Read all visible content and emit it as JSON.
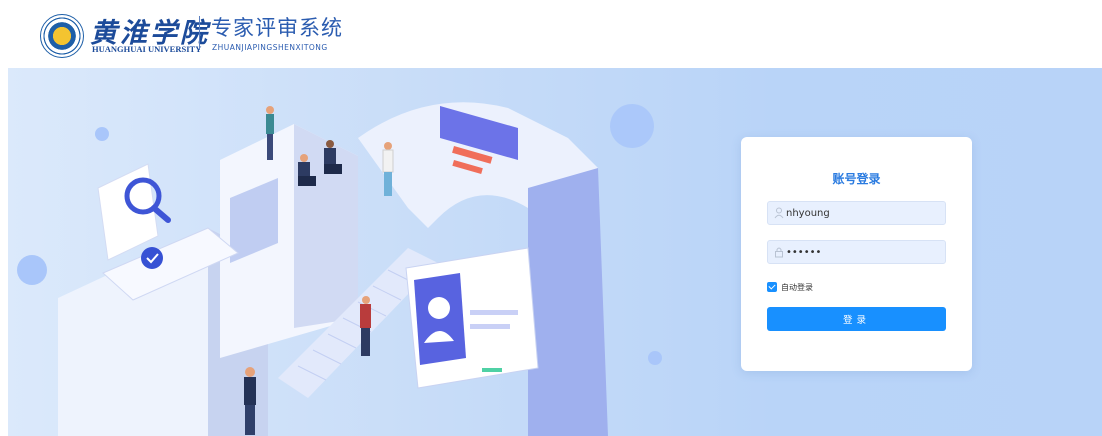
{
  "header": {
    "logo_cn": "黄淮学院",
    "logo_en": "HUANGHUAI UNIVERSITY",
    "system_title": "专家评审系统",
    "system_subtitle": "ZHUANJIAPINGSHENXITONG"
  },
  "login": {
    "title": "账号登录",
    "username_value": "nhyoung",
    "password_value": "123456",
    "remember_label": "自动登录",
    "remember_checked": true,
    "submit_label": "登录"
  },
  "icons": {
    "logo": "university-emblem-icon",
    "username": "user-icon",
    "password": "lock-icon",
    "remember": "checkbox-checked-icon"
  },
  "colors": {
    "brand_blue": "#1c4b9a",
    "primary_button": "#1890ff",
    "title_blue": "#2a7be0",
    "input_bg": "#e8f0fe",
    "banner_bg": "#c7dcf8"
  }
}
